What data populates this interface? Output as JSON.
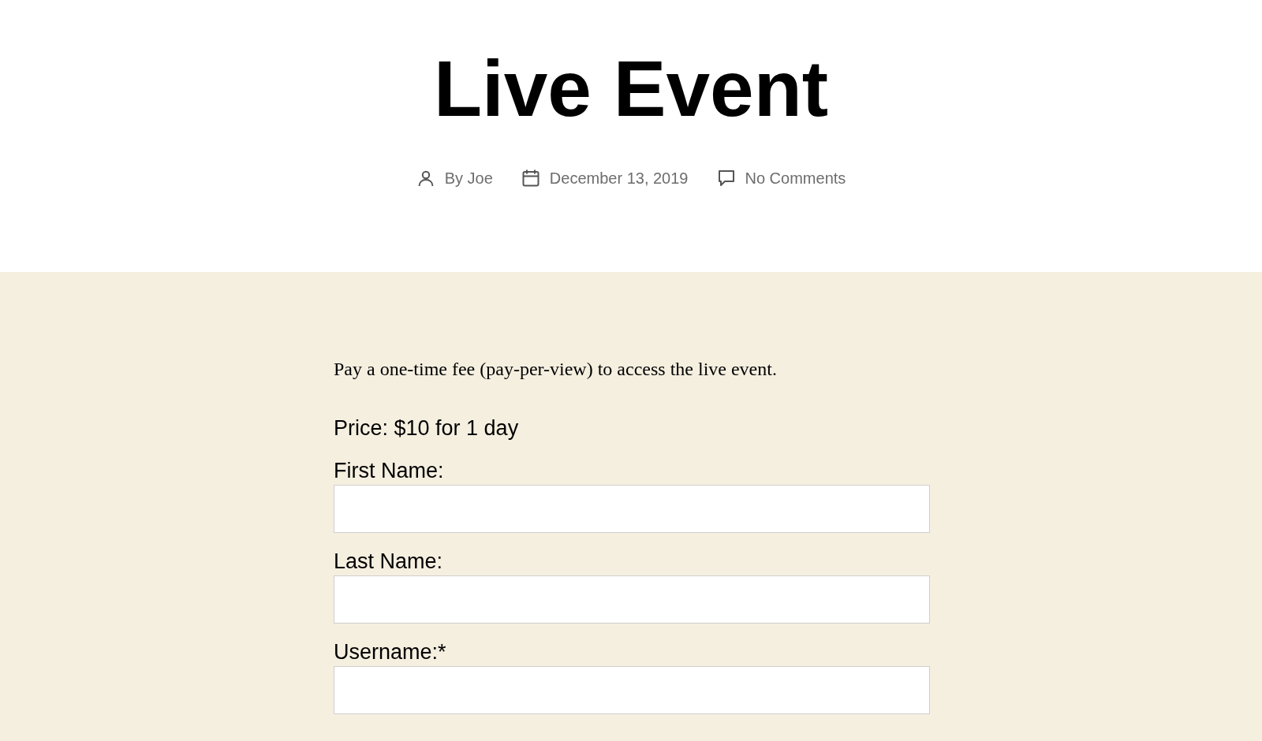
{
  "post": {
    "title": "Live Event",
    "meta": [
      {
        "kind": "author",
        "text": "By Joe"
      },
      {
        "kind": "date",
        "text": "December 13, 2019"
      },
      {
        "kind": "comments",
        "text": "No Comments"
      }
    ]
  },
  "content": {
    "intro": "Pay a one-time fee (pay-per-view) to access the live event.",
    "price": "Price: $10 for 1 day",
    "fields": [
      {
        "label": "First Name:"
      },
      {
        "label": "Last Name:"
      },
      {
        "label": "Username:*"
      }
    ]
  }
}
